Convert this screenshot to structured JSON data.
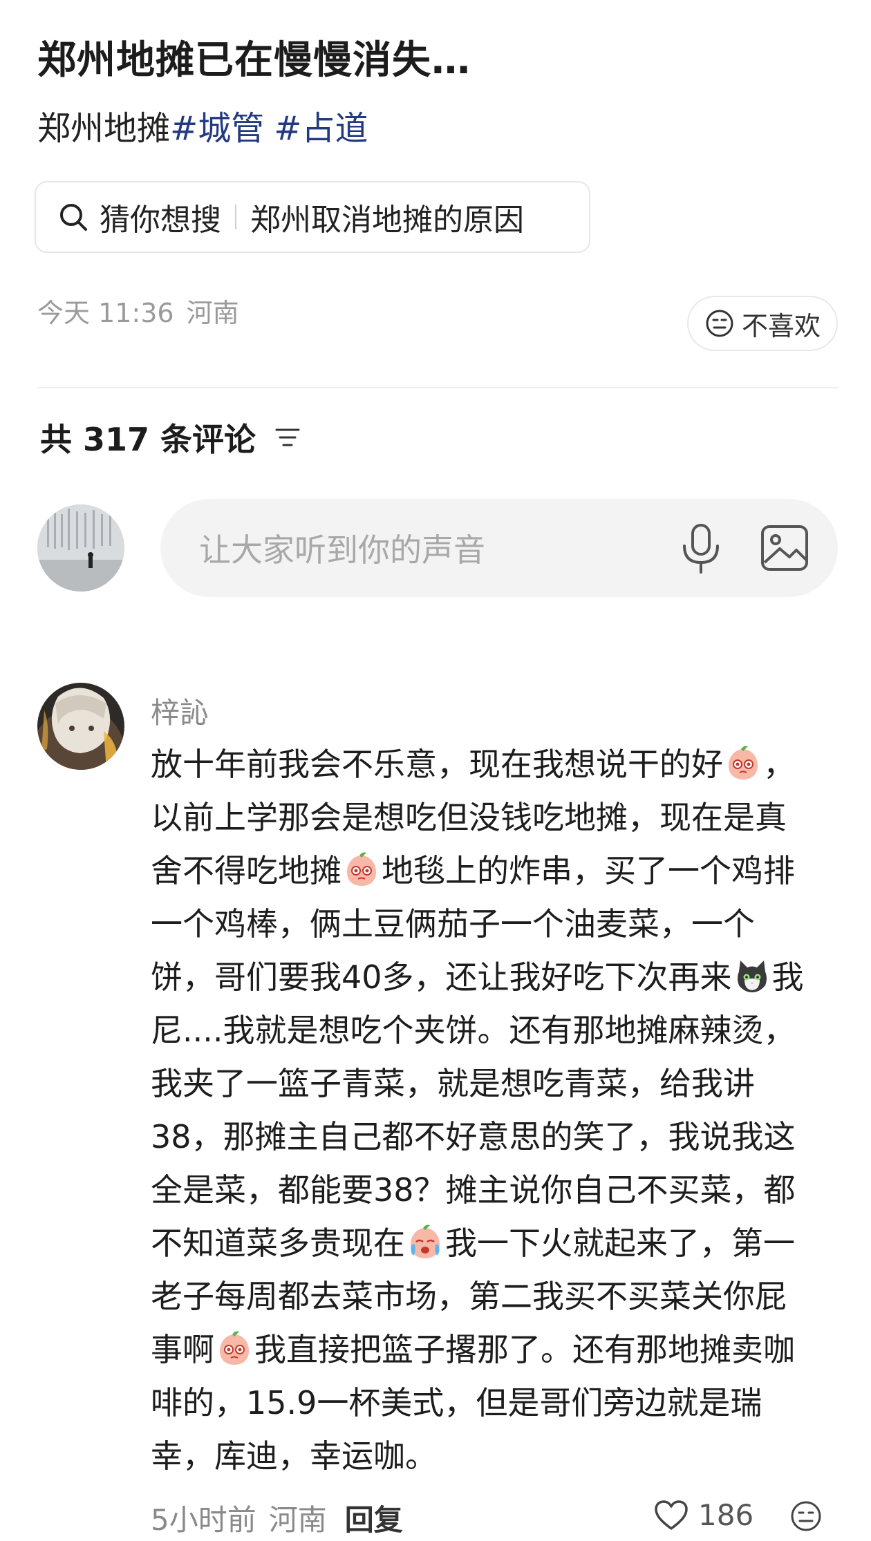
{
  "post": {
    "title": "郑州地摊已在慢慢消失…",
    "lead_text": "郑州地摊",
    "hashtags": [
      "#城管",
      "#占道"
    ]
  },
  "search_suggestion": {
    "label": "猜你想搜",
    "query": "郑州取消地摊的原因",
    "icon": "search-icon"
  },
  "meta": {
    "time": "今天 11:36",
    "location": "河南",
    "dislike_label": "不喜欢"
  },
  "comments_header": {
    "label": "共 317 条评论",
    "sort_icon": "filter-icon"
  },
  "composer": {
    "placeholder": "让大家听到你的声音",
    "icons": [
      "microphone-icon",
      "image-icon"
    ]
  },
  "comment": {
    "author": "梓訫",
    "lines": [
      [
        "放十年前我会不乐意，现在我想说干的好",
        {
          "emoji": "peach-emoji"
        },
        "，"
      ],
      [
        "以前上学那会是想吃但没钱吃地摊，现在是真"
      ],
      [
        "舍不得吃地摊",
        {
          "emoji": "peach-emoji"
        },
        "地毯上的炸串，买了一个鸡排"
      ],
      [
        "一个鸡棒，俩土豆俩茄子一个油麦菜，一个"
      ],
      [
        "饼，哥们要我40多，还让我好吃下次再来",
        {
          "emoji": "cat-emoji"
        },
        "我"
      ],
      [
        "尼....我就是想吃个夹饼。还有那地摊麻辣烫，"
      ],
      [
        "我夹了一篮子青菜，就是想吃青菜，给我讲"
      ],
      [
        "38，那摊主自己都不好意思的笑了，我说我这"
      ],
      [
        "全是菜，都能要38？摊主说你自己不买菜，都"
      ],
      [
        "不知道菜多贵现在",
        {
          "emoji": "crying-peach-emoji"
        },
        "我一下火就起来了，第一"
      ],
      [
        "老子每周都去菜市场，第二我买不买菜关你屁"
      ],
      [
        "事啊",
        {
          "emoji": "peach-emoji"
        },
        "我直接把篮子撂那了。还有那地摊卖咖"
      ],
      [
        "啡的，15.9一杯美式，但是哥们旁边就是瑞"
      ],
      [
        "幸，库迪，幸运咖。"
      ]
    ],
    "time": "5小时前",
    "location": "河南",
    "reply_label": "回复",
    "likes": "186"
  },
  "colors": {
    "hashtag": "#233a80",
    "secondary_text": "#9a9a9a",
    "input_bg": "#f3f3f3"
  }
}
